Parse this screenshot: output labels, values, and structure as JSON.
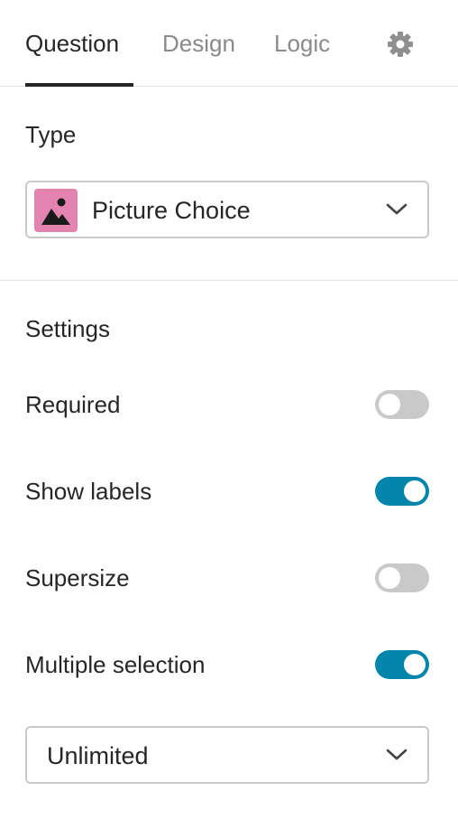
{
  "tabs": [
    {
      "label": "Question",
      "active": true
    },
    {
      "label": "Design",
      "active": false
    },
    {
      "label": "Logic",
      "active": false
    }
  ],
  "settings_icon": "gear-icon",
  "type_section": {
    "title": "Type",
    "selected": "Picture Choice",
    "icon": "picture-icon",
    "icon_color": "#e384b0"
  },
  "settings_section": {
    "title": "Settings",
    "toggles": [
      {
        "label": "Required",
        "on": false
      },
      {
        "label": "Show labels",
        "on": true
      },
      {
        "label": "Supersize",
        "on": false
      },
      {
        "label": "Multiple selection",
        "on": true
      }
    ],
    "limit_select": {
      "selected": "Unlimited"
    }
  },
  "colors": {
    "accent": "#0185ab",
    "toggle_off": "#c9c9c9",
    "text": "#262627",
    "muted_tab": "#8a8a8a"
  }
}
